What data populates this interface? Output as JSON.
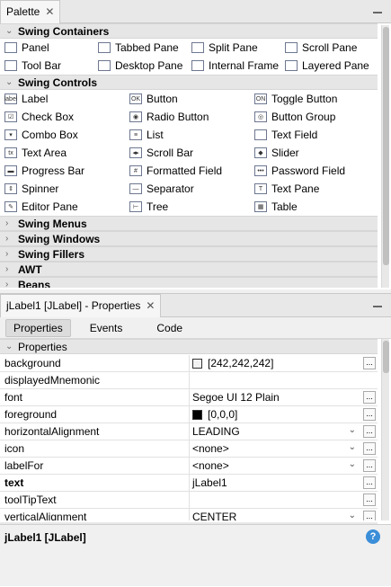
{
  "palette": {
    "tab_label": "Palette",
    "close_glyph": "✕",
    "categories": [
      {
        "label": "Swing Containers",
        "expanded": true,
        "columns": 4,
        "items": [
          {
            "label": "Panel",
            "icon": "panel-icon"
          },
          {
            "label": "Tabbed Pane",
            "icon": "tabbed-pane-icon"
          },
          {
            "label": "Split Pane",
            "icon": "split-pane-icon"
          },
          {
            "label": "Scroll Pane",
            "icon": "scroll-pane-icon"
          },
          {
            "label": "Tool Bar",
            "icon": "tool-bar-icon"
          },
          {
            "label": "Desktop Pane",
            "icon": "desktop-pane-icon"
          },
          {
            "label": "Internal Frame",
            "icon": "internal-frame-icon"
          },
          {
            "label": "Layered Pane",
            "icon": "layered-pane-icon"
          }
        ]
      },
      {
        "label": "Swing Controls",
        "expanded": true,
        "columns": 3,
        "items": [
          {
            "label": "Label",
            "icon": "label-icon",
            "glyph": "label"
          },
          {
            "label": "Button",
            "icon": "button-icon",
            "glyph": "OK"
          },
          {
            "label": "Toggle Button",
            "icon": "toggle-button-icon",
            "glyph": "ON"
          },
          {
            "label": "Check Box",
            "icon": "check-box-icon",
            "glyph": "☑"
          },
          {
            "label": "Radio Button",
            "icon": "radio-button-icon",
            "glyph": "◉"
          },
          {
            "label": "Button Group",
            "icon": "button-group-icon",
            "glyph": "◎"
          },
          {
            "label": "Combo Box",
            "icon": "combo-box-icon",
            "glyph": "▾"
          },
          {
            "label": "List",
            "icon": "list-icon",
            "glyph": "≡"
          },
          {
            "label": "Text Field",
            "icon": "text-field-icon",
            "glyph": ""
          },
          {
            "label": "Text Area",
            "icon": "text-area-icon",
            "glyph": "tx"
          },
          {
            "label": "Scroll Bar",
            "icon": "scroll-bar-icon",
            "glyph": "◂▸"
          },
          {
            "label": "Slider",
            "icon": "slider-icon",
            "glyph": "◆"
          },
          {
            "label": "Progress Bar",
            "icon": "progress-bar-icon",
            "glyph": "▬"
          },
          {
            "label": "Formatted Field",
            "icon": "formatted-field-icon",
            "glyph": "#"
          },
          {
            "label": "Password Field",
            "icon": "password-field-icon",
            "glyph": "•••"
          },
          {
            "label": "Spinner",
            "icon": "spinner-icon",
            "glyph": "⇕"
          },
          {
            "label": "Separator",
            "icon": "separator-icon",
            "glyph": "—"
          },
          {
            "label": "Text Pane",
            "icon": "text-pane-icon",
            "glyph": "T"
          },
          {
            "label": "Editor Pane",
            "icon": "editor-pane-icon",
            "glyph": "✎"
          },
          {
            "label": "Tree",
            "icon": "tree-icon",
            "glyph": "⊢"
          },
          {
            "label": "Table",
            "icon": "table-icon",
            "glyph": "▦"
          }
        ]
      },
      {
        "label": "Swing Menus",
        "expanded": false,
        "items": []
      },
      {
        "label": "Swing Windows",
        "expanded": false,
        "items": []
      },
      {
        "label": "Swing Fillers",
        "expanded": false,
        "items": []
      },
      {
        "label": "AWT",
        "expanded": false,
        "items": []
      },
      {
        "label": "Beans",
        "expanded": false,
        "items": []
      }
    ]
  },
  "properties": {
    "tab_label": "jLabel1 [JLabel] - Properties",
    "close_glyph": "✕",
    "subtabs": [
      "Properties",
      "Events",
      "Code"
    ],
    "section_label": "Properties",
    "rows": [
      {
        "name": "background",
        "value": "[242,242,242]",
        "swatch": "#f2f2f2",
        "button": true
      },
      {
        "name": "displayedMnemonic",
        "value": "",
        "button": false
      },
      {
        "name": "font",
        "value": "Segoe UI 12 Plain",
        "button": true
      },
      {
        "name": "foreground",
        "value": "[0,0,0]",
        "swatch": "#000000",
        "button": true
      },
      {
        "name": "horizontalAlignment",
        "value": "LEADING",
        "dropdown": true,
        "button": true
      },
      {
        "name": "icon",
        "value": "<none>",
        "dropdown": true,
        "button": true
      },
      {
        "name": "labelFor",
        "value": "<none>",
        "dropdown": true,
        "button": true
      },
      {
        "name": "text",
        "value": "jLabel1",
        "bold": true,
        "button": true
      },
      {
        "name": "toolTipText",
        "value": "",
        "button": true
      },
      {
        "name": "verticalAlignment",
        "value": "CENTER",
        "dropdown": true,
        "button": true
      }
    ],
    "description_title": "jLabel1 [JLabel]",
    "help_glyph": "?"
  },
  "colors": {
    "help_blue": "#3b8ed8",
    "category_bg": "#e6e6e6"
  }
}
